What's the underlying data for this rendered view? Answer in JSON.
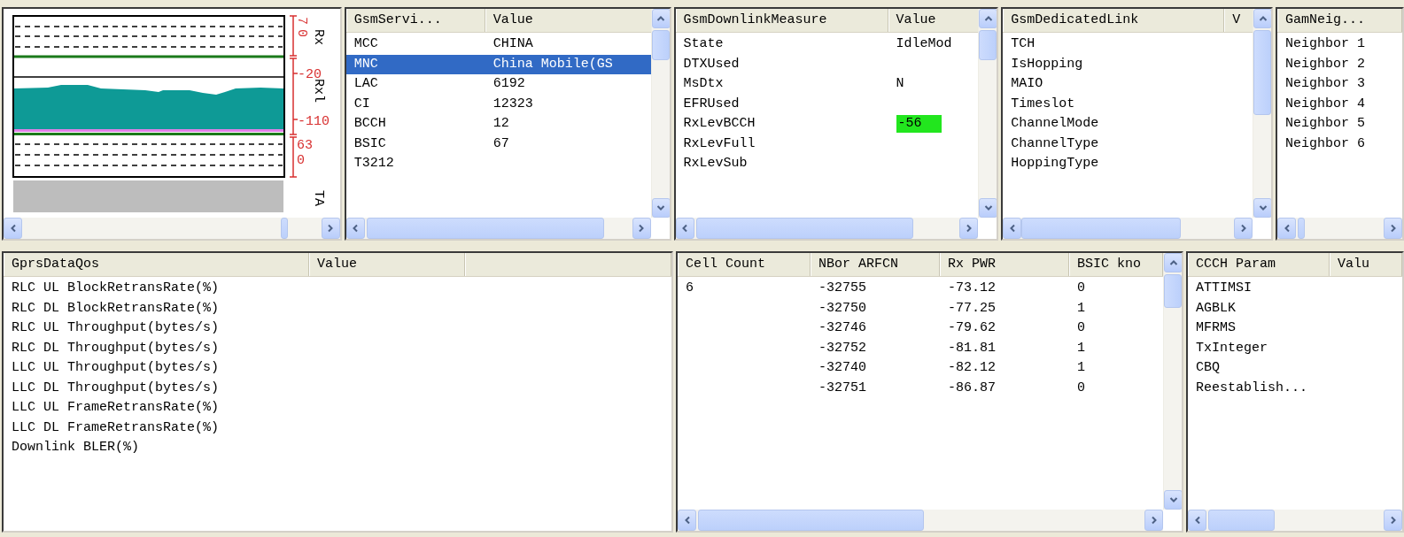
{
  "signal_chart": {
    "rx_scale": [
      "7",
      "0"
    ],
    "rx_title": "Rx",
    "rxl_scale": [
      "-20",
      "-110"
    ],
    "rxl_title": "Rxl",
    "ta_scale": [
      "63",
      "0"
    ],
    "ta_title": "TA"
  },
  "gsm_service": {
    "columns": [
      "GsmServi...",
      "Value"
    ],
    "rows": [
      {
        "name": "MCC",
        "value": "CHINA",
        "selected": false
      },
      {
        "name": "MNC",
        "value": "China Mobile(GS",
        "selected": true
      },
      {
        "name": "LAC",
        "value": "6192",
        "selected": false
      },
      {
        "name": "CI",
        "value": "12323",
        "selected": false
      },
      {
        "name": "BCCH",
        "value": "12",
        "selected": false
      },
      {
        "name": "BSIC",
        "value": "67",
        "selected": false
      },
      {
        "name": "T3212",
        "selected": false
      }
    ]
  },
  "gsm_downlink_measure": {
    "columns": [
      "GsmDownlinkMeasure",
      "Value"
    ],
    "rows": [
      {
        "name": "State",
        "value": "IdleMod",
        "selected": false
      },
      {
        "name": "DTXUsed",
        "selected": false
      },
      {
        "name": "MsDtx",
        "value": "N",
        "selected": false
      },
      {
        "name": "EFRUsed",
        "selected": false
      },
      {
        "name": "RxLevBCCH",
        "value": "-56",
        "color": "#22e61e",
        "selected": false
      },
      {
        "name": "RxLevFull",
        "selected": false
      },
      {
        "name": "RxLevSub",
        "selected": false
      }
    ]
  },
  "gsm_dedicated_link": {
    "columns": [
      "GsmDedicatedLink",
      "V"
    ],
    "rows": [
      {
        "name": "TCH",
        "selected": false
      },
      {
        "name": "IsHopping",
        "selected": false
      },
      {
        "name": "MAIO",
        "selected": false
      },
      {
        "name": "Timeslot",
        "selected": false
      },
      {
        "name": "ChannelMode",
        "selected": false
      },
      {
        "name": "ChannelType",
        "selected": false
      },
      {
        "name": "HoppingType",
        "selected": false
      }
    ]
  },
  "gsm_neighbor": {
    "columns": [
      "GamNeig..."
    ],
    "rows": [
      {
        "name": "Neighbor 1",
        "selected": false
      },
      {
        "name": "Neighbor 2",
        "selected": false
      },
      {
        "name": "Neighbor 3",
        "selected": false
      },
      {
        "name": "Neighbor 4",
        "selected": false
      },
      {
        "name": "Neighbor 5",
        "selected": false
      },
      {
        "name": "Neighbor 6",
        "selected": false
      }
    ]
  },
  "gprs_data_qos": {
    "columns": [
      "GprsDataQos",
      "Value"
    ],
    "rows": [
      {
        "name": "RLC UL BlockRetransRate(%)",
        "selected": false
      },
      {
        "name": "RLC DL BlockRetransRate(%)",
        "selected": false
      },
      {
        "name": "RLC UL Throughput(bytes/s)",
        "selected": false
      },
      {
        "name": "RLC DL Throughput(bytes/s)",
        "selected": false
      },
      {
        "name": "LLC UL Throughput(bytes/s)",
        "selected": false
      },
      {
        "name": "LLC DL Throughput(bytes/s)",
        "selected": false
      },
      {
        "name": "LLC UL FrameRetransRate(%)",
        "selected": false
      },
      {
        "name": "LLC DL FrameRetransRate(%)",
        "selected": false
      },
      {
        "name": "Downlink BLER(%)",
        "selected": false
      }
    ]
  },
  "neighbor_cells": {
    "columns": [
      "Cell Count",
      "NBor ARFCN",
      "Rx PWR",
      "BSIC kno"
    ],
    "rows": [
      {
        "cell_count": "6",
        "nbor_arfcn": "-32755",
        "rx_pwr": "-73.12",
        "column_4": "0",
        "selected": false
      },
      {
        "nbor_arfcn": "-32750",
        "rx_pwr": "-77.25",
        "column_4": "1",
        "selected": false
      },
      {
        "nbor_arfcn": "-32746",
        "rx_pwr": "-79.62",
        "column_4": "0",
        "selected": false
      },
      {
        "nbor_arfcn": "-32752",
        "rx_pwr": "-81.81",
        "column_4": "1",
        "selected": false
      },
      {
        "nbor_arfcn": "-32740",
        "rx_pwr": "-82.12",
        "column_4": "1",
        "selected": false
      },
      {
        "nbor_arfcn": "-32751",
        "rx_pwr": "-86.87",
        "column_4": "0",
        "selected": false
      }
    ]
  },
  "ccch_param": {
    "columns": [
      "CCCH Param",
      "Valu"
    ],
    "rows": [
      {
        "name": "ATTIMSI",
        "selected": false
      },
      {
        "name": "AGBLK",
        "selected": false
      },
      {
        "name": "MFRMS",
        "selected": false
      },
      {
        "name": "TxInteger",
        "selected": false
      },
      {
        "name": "CBQ",
        "selected": false
      },
      {
        "name": "Reestablish...",
        "selected": false
      }
    ]
  }
}
